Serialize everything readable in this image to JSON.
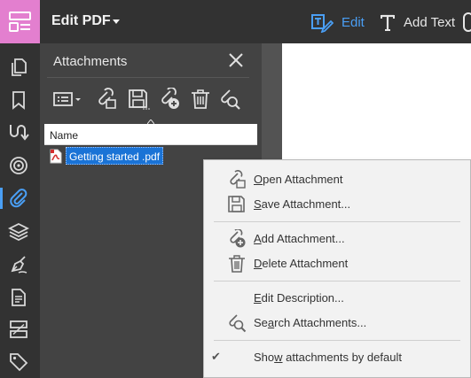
{
  "toolbar": {
    "title": "Edit PDF",
    "edit_label": "Edit",
    "add_text_label": "Add Text",
    "accent": "#4a9ff5"
  },
  "rail": {
    "icons": [
      "pages-icon",
      "bookmark-icon",
      "signature-path-icon",
      "target-icon",
      "attachment-icon",
      "layers-icon",
      "fill-sign-icon",
      "document-icon",
      "compare-icon",
      "tag-icon"
    ],
    "active": "attachment-icon"
  },
  "panel": {
    "title": "Attachments",
    "tools": [
      "options-menu-icon",
      "open-attachment-icon",
      "save-attachment-icon",
      "add-attachment-icon",
      "delete-attachment-icon",
      "search-attachments-icon"
    ],
    "column_header": "Name",
    "rows": [
      {
        "name": "Getting started .pdf",
        "selected": true
      }
    ]
  },
  "menu": {
    "items": [
      {
        "pre": "",
        "u": "O",
        "post": "pen Attachment",
        "icon": "open-attachment-icon",
        "group": 1
      },
      {
        "pre": "",
        "u": "S",
        "post": "ave Attachment...",
        "icon": "save-attachment-icon",
        "group": 1
      },
      {
        "pre": "",
        "u": "A",
        "post": "dd Attachment...",
        "icon": "add-attachment-icon",
        "group": 2
      },
      {
        "pre": "",
        "u": "D",
        "post": "elete Attachment",
        "icon": "delete-attachment-icon",
        "group": 2
      },
      {
        "pre": "",
        "u": "E",
        "post": "dit Description...",
        "icon": "",
        "group": 3
      },
      {
        "pre": "Se",
        "u": "a",
        "post": "rch Attachments...",
        "icon": "search-attachments-icon",
        "group": 3
      },
      {
        "pre": "Sho",
        "u": "w",
        "post": " attachments by default",
        "icon": "",
        "checked": true,
        "group": 4
      }
    ]
  }
}
